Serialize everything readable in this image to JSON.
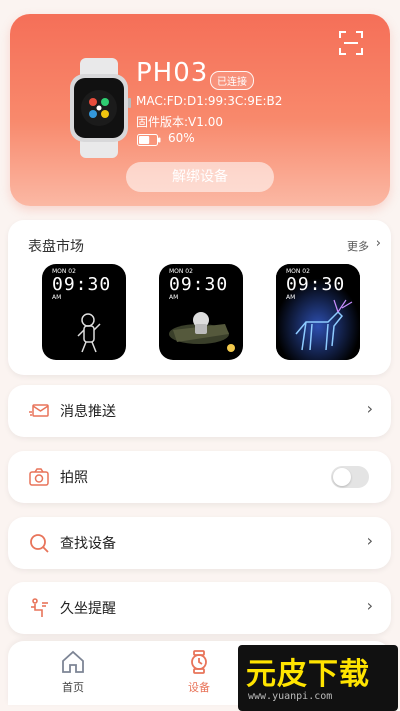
{
  "device": {
    "name": "PH03",
    "status": "已连接",
    "mac": "MAC:FD:D1:99:3C:9E:B2",
    "firmware": "固件版本:V1.00",
    "battery": "60%",
    "battery_level": 0.6,
    "unbind_label": "解绑设备",
    "scan_icon": "scan-icon"
  },
  "market": {
    "title": "表盘市场",
    "more_label": "更多",
    "faces": [
      {
        "date": "MON 02",
        "time": "09:30",
        "ampm": "AM",
        "theme": "astronaut-standing"
      },
      {
        "date": "MON 02",
        "time": "09:30",
        "ampm": "AM",
        "theme": "astronaut-boat"
      },
      {
        "date": "MON 02",
        "time": "09:30",
        "ampm": "AM",
        "theme": "neon-deer"
      }
    ]
  },
  "menu": {
    "message_push": "消息推送",
    "camera": "拍照",
    "find_device": "查找设备",
    "sedentary": "久坐提醒"
  },
  "nav": {
    "home": "首页",
    "device": "设备"
  },
  "watermark": {
    "text": "元皮下载",
    "url": "www.yuanpi.com"
  },
  "colors": {
    "accent": "#f56f58",
    "icon_orange": "#e8745a"
  }
}
